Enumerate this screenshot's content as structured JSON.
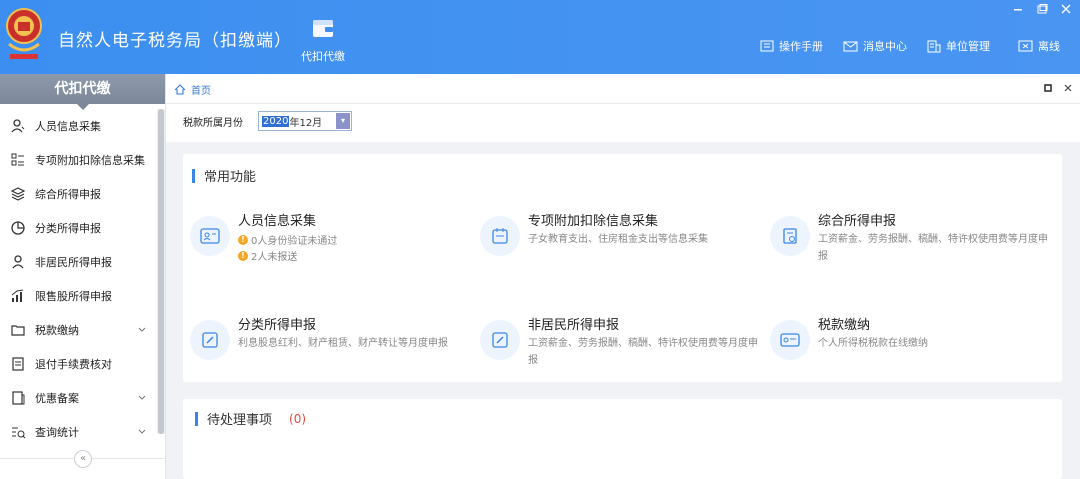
{
  "app": {
    "title": "自然人电子税务局（扣缴端）",
    "toolbar_label": "代扣代缴"
  },
  "top_links": [
    {
      "label": "操作手册",
      "icon": "book-icon"
    },
    {
      "label": "消息中心",
      "icon": "mail-icon"
    },
    {
      "label": "单位管理",
      "icon": "building-icon"
    },
    {
      "label": "离线",
      "icon": "offline-icon"
    }
  ],
  "sidebar": {
    "header": "代扣代缴",
    "items": [
      {
        "label": "人员信息采集",
        "icon": "person-icon"
      },
      {
        "label": "专项附加扣除信息采集",
        "icon": "list-icon"
      },
      {
        "label": "综合所得申报",
        "icon": "layers-icon"
      },
      {
        "label": "分类所得申报",
        "icon": "pie-icon"
      },
      {
        "label": "非居民所得申报",
        "icon": "user-icon"
      },
      {
        "label": "限售股所得申报",
        "icon": "chart-icon"
      },
      {
        "label": "税款缴纳",
        "icon": "folder-icon"
      },
      {
        "label": "退付手续费核对",
        "icon": "doc-icon"
      },
      {
        "label": "优惠备案",
        "icon": "copy-icon"
      },
      {
        "label": "查询统计",
        "icon": "search-list-icon"
      }
    ],
    "collapse": "«"
  },
  "breadcrumb": {
    "home": "首页"
  },
  "period": {
    "label": "税款所属月份",
    "year": "2020",
    "month": "年12月"
  },
  "common": {
    "title": "常用功能",
    "functions": [
      {
        "name": "人员信息采集",
        "warn1": "0人身份验证未通过",
        "warn2": "2人未报送"
      },
      {
        "name": "专项附加扣除信息采集",
        "desc": "子女教育支出、住房租金支出等信息采集"
      },
      {
        "name": "综合所得申报",
        "desc": "工资薪金、劳务报酬、稿酬、特许权使用费等月度申报"
      },
      {
        "name": "分类所得申报",
        "desc": "利息股息红利、财产租赁、财产转让等月度申报"
      },
      {
        "name": "非居民所得申报",
        "desc": "工资薪金、劳务报酬、稿酬、特许权使用费等月度申报"
      },
      {
        "name": "税款缴纳",
        "desc": "个人所得税税款在线缴纳"
      }
    ]
  },
  "pending": {
    "title": "待处理事项",
    "count": "(0)"
  },
  "colors": {
    "header": "#3c8ff0",
    "accent": "#3a86e8",
    "sidebar_head": "#7c889a",
    "warn": "#f5a623",
    "count": "#e24b3b"
  }
}
